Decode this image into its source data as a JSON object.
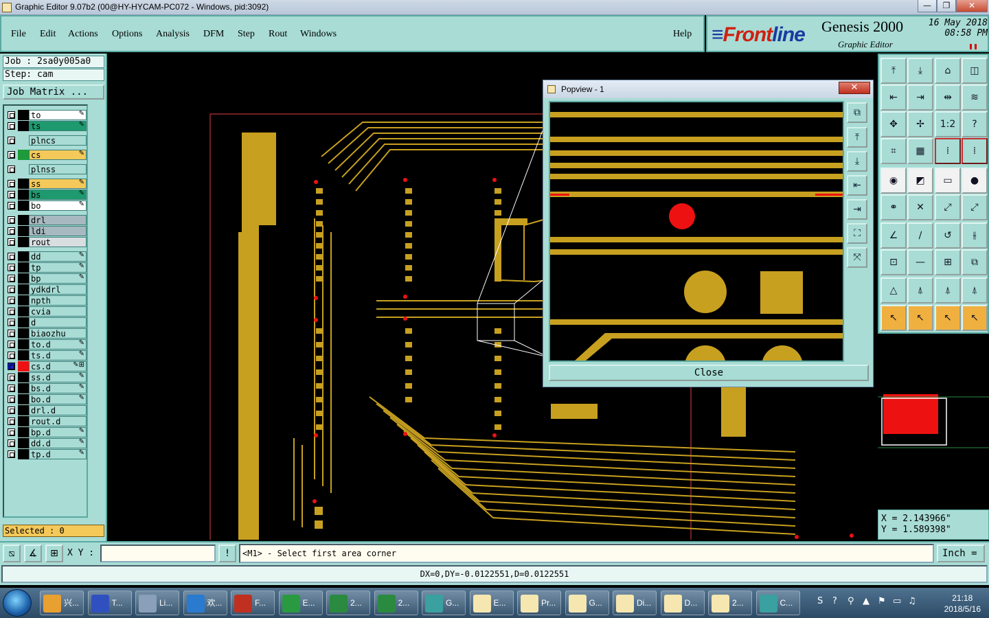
{
  "window": {
    "title": "Graphic Editor 9.07b2 (00@HY-HYCAM-PC072 - Windows, pid:3092)",
    "controls": {
      "minimize": "—",
      "restore": "❐",
      "close": "✕"
    }
  },
  "menu": {
    "items": [
      "File",
      "Edit",
      "Actions",
      "Options",
      "Analysis",
      "DFM",
      "Step",
      "Rout",
      "Windows"
    ],
    "help": "Help"
  },
  "brand": {
    "logo_prefix": "Front",
    "logo_suffix": "line",
    "product": "Genesis 2000",
    "subtitle": "Graphic Editor",
    "date": "16 May 2018",
    "time": "08:58 PM"
  },
  "job": {
    "job_line": "Job : 2sa0y005a0",
    "step_line": "Step: cam",
    "matrix_button": "Job Matrix ..."
  },
  "layers": [
    {
      "name": "to",
      "color": "#ffffff",
      "swatch": "#000000",
      "state": "✎"
    },
    {
      "name": "ts",
      "color": "#1f9a6e",
      "swatch": "#000000",
      "state": "✎"
    },
    {
      "name": "plncs",
      "color": "#a8dcd5",
      "swatch": "#a8dcd5",
      "state": ""
    },
    {
      "name": "cs",
      "color": "#f4c95a",
      "swatch": "#1f9a3a",
      "state": "✎"
    },
    {
      "name": "plnss",
      "color": "#a8dcd5",
      "swatch": "#a8dcd5",
      "state": ""
    },
    {
      "name": "ss",
      "color": "#f4c95a",
      "swatch": "#000000",
      "state": "✎"
    },
    {
      "name": "bs",
      "color": "#1f9a6e",
      "swatch": "#000000",
      "state": "✎"
    },
    {
      "name": "bo",
      "color": "#ffffff",
      "swatch": "#000000",
      "state": "✎"
    },
    {
      "name": "drl",
      "color": "#a8b8c0",
      "swatch": "#000000",
      "state": ""
    },
    {
      "name": "ldi",
      "color": "#a8b8c0",
      "swatch": "#000000",
      "state": ""
    },
    {
      "name": "rout",
      "color": "#d8dde0",
      "swatch": "#000000",
      "state": ""
    },
    {
      "name": "dd",
      "color": "#a8dcd5",
      "swatch": "#000000",
      "state": "✎"
    },
    {
      "name": "tp",
      "color": "#a8dcd5",
      "swatch": "#000000",
      "state": "✎"
    },
    {
      "name": "bp",
      "color": "#a8dcd5",
      "swatch": "#000000",
      "state": "✎"
    },
    {
      "name": "ydkdrl",
      "color": "#a8dcd5",
      "swatch": "#000000",
      "state": ""
    },
    {
      "name": "npth",
      "color": "#a8dcd5",
      "swatch": "#000000",
      "state": ""
    },
    {
      "name": "cvia",
      "color": "#a8dcd5",
      "swatch": "#000000",
      "state": ""
    },
    {
      "name": "d",
      "color": "#a8dcd5",
      "swatch": "#000000",
      "state": ""
    },
    {
      "name": "biaozhu",
      "color": "#a8dcd5",
      "swatch": "#000000",
      "state": ""
    },
    {
      "name": "to.d",
      "color": "#a8dcd5",
      "swatch": "#000000",
      "state": "✎"
    },
    {
      "name": "ts.d",
      "color": "#a8dcd5",
      "swatch": "#000000",
      "state": "✎"
    },
    {
      "name": "cs.d",
      "color": "#a8dcd5",
      "swatch": "#ee1111",
      "state": "✎⊞"
    },
    {
      "name": "ss.d",
      "color": "#a8dcd5",
      "swatch": "#000000",
      "state": "✎"
    },
    {
      "name": "bs.d",
      "color": "#a8dcd5",
      "swatch": "#000000",
      "state": "✎"
    },
    {
      "name": "bo.d",
      "color": "#a8dcd5",
      "swatch": "#000000",
      "state": "✎"
    },
    {
      "name": "drl.d",
      "color": "#a8dcd5",
      "swatch": "#000000",
      "state": ""
    },
    {
      "name": "rout.d",
      "color": "#a8dcd5",
      "swatch": "#000000",
      "state": ""
    },
    {
      "name": "bp.d",
      "color": "#a8dcd5",
      "swatch": "#000000",
      "state": "✎"
    },
    {
      "name": "dd.d",
      "color": "#a8dcd5",
      "swatch": "#000000",
      "state": "✎"
    },
    {
      "name": "tp.d",
      "color": "#a8dcd5",
      "swatch": "#000000",
      "state": "✎"
    }
  ],
  "selected": "Selected : 0",
  "popview": {
    "title": "Popview - 1",
    "close_label": "Close",
    "tools": [
      "⧉",
      "⤒",
      "⤓",
      "⇤",
      "⇥",
      "⛶",
      "⤧"
    ]
  },
  "tools": [
    [
      "⤒",
      "⤓",
      "⌂",
      "◫"
    ],
    [
      "⇤",
      "⇥",
      "⇹",
      "≋"
    ],
    [
      "✥",
      "✢",
      "1:2",
      "?"
    ],
    [
      "⌗",
      "▦",
      "⁞",
      "⁞"
    ],
    [
      "◉",
      "◩",
      "▭",
      "●"
    ],
    [
      "⚭",
      "✕",
      "⤢",
      "⤢"
    ],
    [
      "∠",
      "∕",
      "↺",
      "⫳"
    ],
    [
      "⊡",
      "—",
      "⊞",
      "⧉"
    ],
    [
      "△",
      "⍋",
      "⍋",
      "⍋"
    ],
    [
      "↖",
      "↖",
      "↖",
      "↖"
    ]
  ],
  "overview": {
    "frame_color": "#ffffff",
    "fill_color": "#ee1111"
  },
  "coords": {
    "x": "X = 2.143966\"",
    "y": "Y = 1.589398\""
  },
  "command": {
    "xy_label": "X Y :",
    "xy_value": "",
    "alert_icon": "!",
    "message": "<M1> - Select first area corner",
    "units": "Inch ="
  },
  "status": "DX=0,DY=-0.0122551,D=0.0122551",
  "taskbar": {
    "tasks": [
      {
        "label": "兴...",
        "color": "#e8a030"
      },
      {
        "label": "T...",
        "color": "#3050c0"
      },
      {
        "label": "Li...",
        "color": "#8aa0b8"
      },
      {
        "label": "欢...",
        "color": "#2a7ad0"
      },
      {
        "label": "F...",
        "color": "#c03020"
      },
      {
        "label": "E...",
        "color": "#2a9a40"
      },
      {
        "label": "2...",
        "color": "#2a8a40"
      },
      {
        "label": "2...",
        "color": "#2a8a40"
      },
      {
        "label": "G...",
        "color": "#3aa0a0"
      },
      {
        "label": "E...",
        "color": "#f6e7b0"
      },
      {
        "label": "Pr...",
        "color": "#f6e7b0"
      },
      {
        "label": "G...",
        "color": "#f6e7b0"
      },
      {
        "label": "Di...",
        "color": "#f6e7b0"
      },
      {
        "label": "D...",
        "color": "#f6e7b0"
      },
      {
        "label": "2...",
        "color": "#f6e7b0"
      },
      {
        "label": "C...",
        "color": "#3aa0a0"
      }
    ],
    "clock_time": "21:18",
    "clock_date": "2018/5/16",
    "tray_icons": [
      "S",
      "?",
      "⚲",
      "▲",
      "⚑",
      "▭",
      "♫"
    ]
  }
}
